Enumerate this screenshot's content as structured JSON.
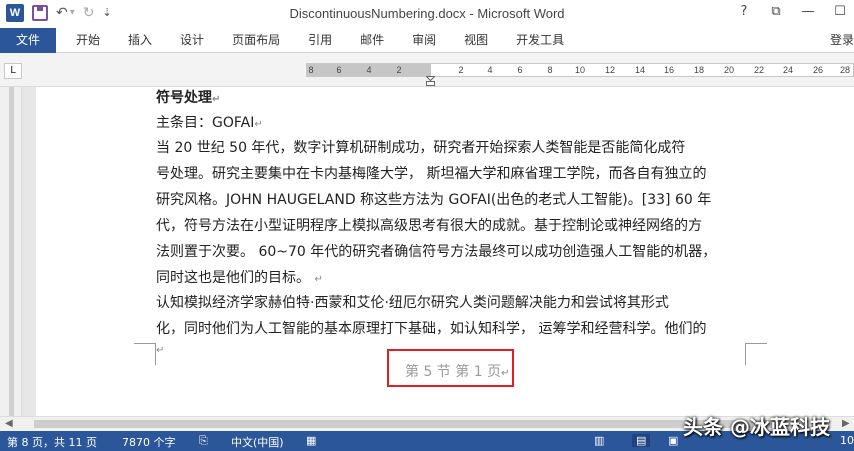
{
  "window": {
    "title": "DiscontinuousNumbering.docx - Microsoft Word",
    "help": "?",
    "restore_ribbon": "⧉",
    "minimize": "—",
    "maximize": "☐",
    "qat": {
      "app_icon": "W",
      "undo": "↶",
      "undo_dropdown": "▾",
      "redo": "↻",
      "customize": "⇣"
    }
  },
  "ribbon": {
    "tabs": [
      "文件",
      "开始",
      "插入",
      "设计",
      "页面布局",
      "引用",
      "邮件",
      "审阅",
      "视图",
      "开发工具"
    ],
    "signin": "登录"
  },
  "ruler": {
    "corner": "L",
    "left_numbers": [
      "8",
      "6",
      "4",
      "2"
    ],
    "right_numbers": [
      "2",
      "4",
      "6",
      "8",
      "10",
      "12",
      "14",
      "16",
      "18",
      "20",
      "22",
      "24",
      "26",
      "28"
    ]
  },
  "document": {
    "heading": "符号处理",
    "subheading": "主条目：GOFAI",
    "paragraph1": [
      "当 20 世纪 50 年代，数字计算机研制成功，研究者开始探索人类智能是否能简化成符",
      "号处理。研究主要集中在卡内基梅隆大学， 斯坦福大学和麻省理工学院，而各自有独立的",
      "研究风格。JOHN HAUGELAND 称这些方法为 GOFAI(出色的老式人工智能)。[33] 60 年",
      "代，符号方法在小型证明程序上模拟高级思考有很大的成就。基于控制论或神经网络的方",
      "法则置于次要。 60~70 年代的研究者确信符号方法最终可以成功创造强人工智能的机器，",
      "同时这也是他们的目标。"
    ],
    "paragraph2": [
      "认知模拟经济学家赫伯特·西蒙和艾伦·纽厄尔研究人类问题解决能力和尝试将其形式",
      "化，同时他们为人工智能的基本原理打下基础，如认知科学， 运筹学和经营科学。他们的"
    ],
    "para_mark": "↵",
    "footer": "第 5 节 第 1 页"
  },
  "status_bar": {
    "page": "第 8 页，共 11 页",
    "words": "7870 个字",
    "language": "中文(中国)",
    "zoom": "10"
  },
  "watermark": "头条 @冰蓝科技",
  "colors": {
    "brand": "#2b579a",
    "highlight_box": "#e02020"
  }
}
